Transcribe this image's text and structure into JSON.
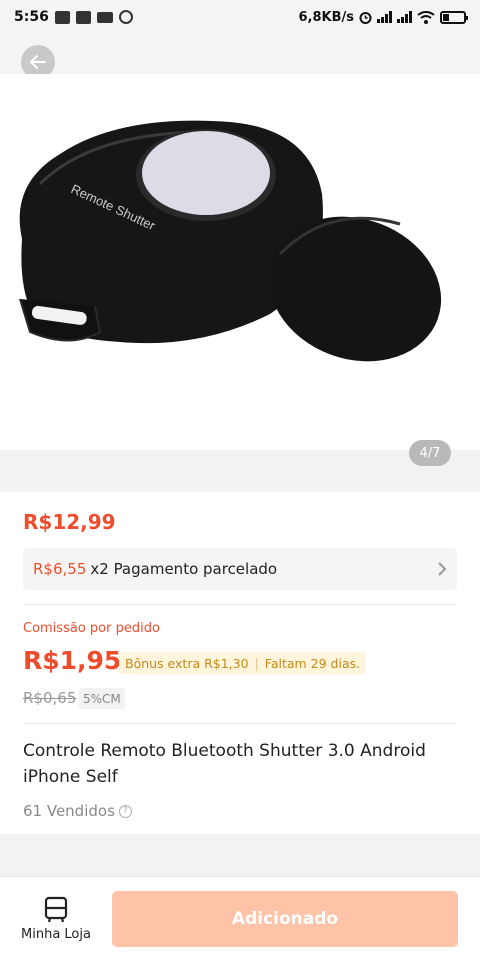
{
  "status_bar": {
    "time": "5:56",
    "network_speed": "6,8KB/s",
    "icons": [
      "app-icon",
      "app-icon",
      "video-icon",
      "whatsapp-icon",
      "alarm-icon",
      "signal-icon",
      "signal-icon",
      "wifi-icon",
      "battery-icon"
    ],
    "battery_level": 0.3
  },
  "header": {
    "back_icon": "arrow-left-icon"
  },
  "gallery": {
    "counter": "4/7",
    "image": "remote-shutter-product-photo",
    "product_print": "Remote Shutter"
  },
  "product": {
    "price": "R$12,99",
    "installment": {
      "amount": "R$6,55",
      "text": "x2 Pagamento parcelado",
      "chevron": "chevron-right-icon"
    },
    "commission": {
      "label": "Comissão por pedido",
      "value": "R$1,95",
      "bonus": "Bônus extra R$1,30",
      "remaining": "Faltam 29 dias.",
      "old_value": "R$0,65",
      "rate": "5%CM"
    },
    "title": "Controle Remoto Bluetooth Shutter 3.0 Android iPhone Self",
    "sold": "61 Vendidos",
    "help_icon": "question-circle-icon"
  },
  "bottom_bar": {
    "store_label": "Minha Loja",
    "store_icon": "store-icon",
    "add_label": "Adicionado"
  },
  "colors": {
    "accent": "#ee4d2d",
    "button_disabled": "#ffc3a8",
    "bonus_bg": "#fff4dc",
    "bonus_text": "#c58a1b"
  }
}
